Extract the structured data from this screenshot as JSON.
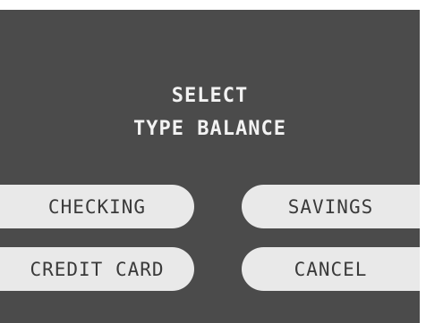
{
  "screen": {
    "prompt_line1": "SELECT",
    "prompt_line2": "TYPE BALANCE"
  },
  "buttons": {
    "checking": "CHECKING",
    "savings": "SAVINGS",
    "credit_card": "CREDIT CARD",
    "cancel": "CANCEL"
  },
  "colors": {
    "screen_background": "#4b4b4b",
    "button_background": "#e9e9e9",
    "button_text": "#3a3a3a",
    "prompt_text": "#f2f2f2"
  }
}
